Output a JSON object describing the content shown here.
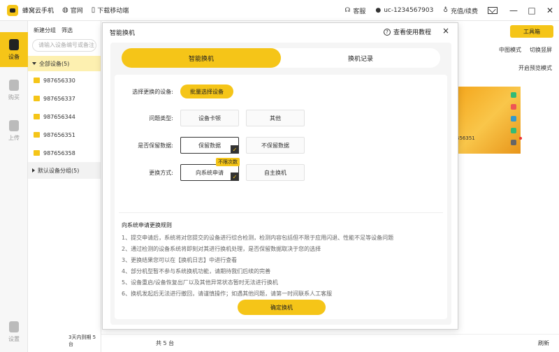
{
  "titlebar": {
    "app_name": "蜂窝云手机",
    "links": [
      "官网",
      "下载移动端"
    ],
    "support": "客服",
    "user_id": "uc-1234567903",
    "recharge": "充值/续费"
  },
  "nav": {
    "items": [
      {
        "label": "设备",
        "active": true
      },
      {
        "label": "购买",
        "active": false
      },
      {
        "label": "上传",
        "active": false
      }
    ],
    "settings": "设置"
  },
  "device_panel": {
    "new_group": "新建分组",
    "filter": "筛选",
    "select_all": "全选",
    "search_placeholder": "请输入设备编号或备注",
    "all_devices": "全部设备(5)",
    "devices": [
      "987656330",
      "987656337",
      "987656344",
      "987656351",
      "987656358"
    ],
    "default_group": "默认设备分组(5)",
    "expiring": "3天内到期 5 台"
  },
  "main": {
    "toolbox": "工具箱",
    "mode": "中图模式",
    "switch_mode": "切换竖屏",
    "preview": "开启预览模式",
    "phone_label": "656351",
    "total": "共 5 台",
    "refresh": "刷新"
  },
  "dialog": {
    "title": "智能换机",
    "help": "查看使用教程",
    "close": "×",
    "tabs": [
      "智能换机",
      "换机记录"
    ],
    "select_label": "选择更换的设备:",
    "batch_select": "批量选择设备",
    "issue_label": "问题类型:",
    "issue_options": [
      "设备卡顿",
      "其他"
    ],
    "keep_label": "是否保留数据:",
    "keep_options": [
      "保留数据",
      "不保留数据"
    ],
    "method_label": "更换方式:",
    "method_options": [
      "向系统申请",
      "自主换机"
    ],
    "unlimited_tag": "不限次数",
    "rules_title": "向系统申请更换规则",
    "rules": [
      "1、提交申请后，系统将对您提交的设备进行综合检测，检测内容包括但不限于应用闪退、性能不足等设备问题",
      "2、通过检测的设备系统将即刻对其进行换机处理，是否保留数据取决于您的选择",
      "3、更换结果您可以在【换机日志】中进行查看",
      "4、部分机型暂不参与系统换机功能，请期待我们后续的完善",
      "5、设备重启/设备恢复出厂以及其他异常状态暂时无法进行换机",
      "6、换机发起后无法进行撤回，请谨慎操作；如遇其他问题，请第一时间联系人工客服"
    ],
    "confirm": "确定换机"
  }
}
